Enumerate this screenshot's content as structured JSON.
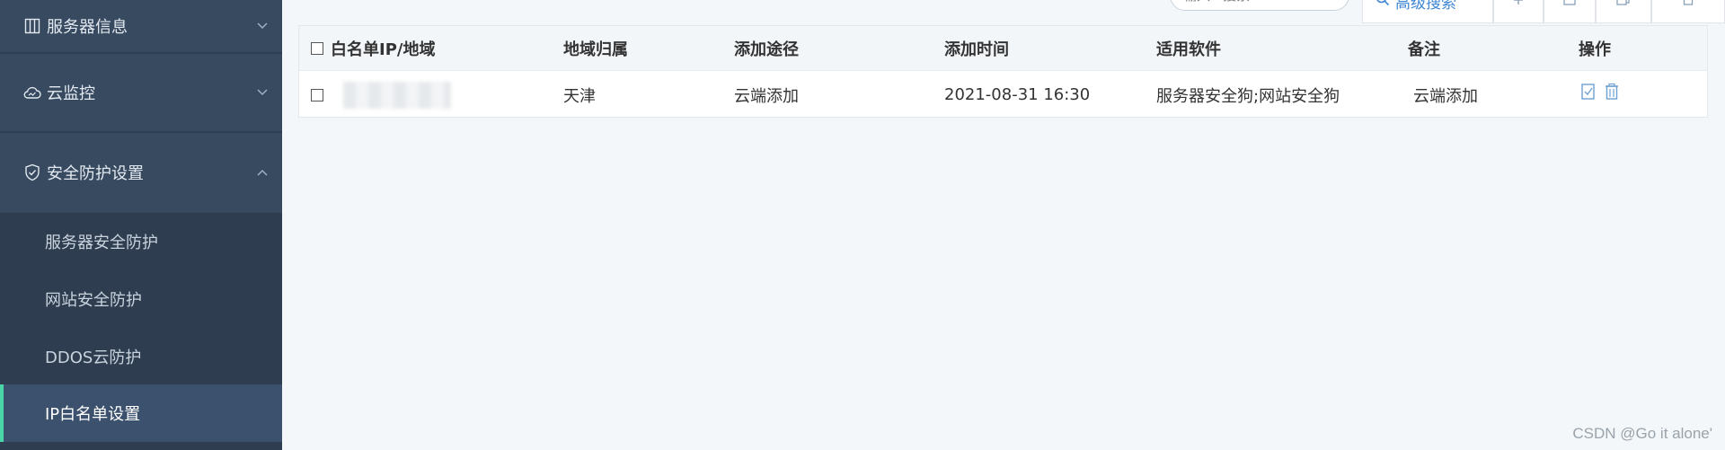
{
  "sidebar": {
    "groups": [
      {
        "label": "服务器信息",
        "icon": "server-columns-icon"
      },
      {
        "label": "云监控",
        "icon": "cloud-icon"
      },
      {
        "label": "安全防护设置",
        "icon": "shield-icon"
      }
    ],
    "submenu": [
      {
        "label": "服务器安全防护"
      },
      {
        "label": "网站安全防护"
      },
      {
        "label": "DDOS云防护"
      },
      {
        "label": "IP白名单设置",
        "active": true
      }
    ]
  },
  "toolbar": {
    "search_placeholder": "输入IP搜索",
    "advanced_search": "高级搜索"
  },
  "table": {
    "headers": {
      "ip": "白名单IP/地域",
      "region": "地域归属",
      "method": "添加途径",
      "time": "添加时间",
      "software": "适用软件",
      "note": "备注",
      "action": "操作"
    },
    "rows": [
      {
        "region": "天津",
        "method": "云端添加",
        "time": "2021-08-31 16:30",
        "software": "服务器安全狗;网站安全狗",
        "note": "云端添加"
      }
    ]
  },
  "watermark": "CSDN @Go it alone'",
  "colors": {
    "sidebar_bg": "#384a60",
    "submenu_bg": "#2e3d4f",
    "active_item_bg": "#3b516d",
    "active_indicator": "#4ad6a6",
    "link_blue": "#3e86d6"
  }
}
